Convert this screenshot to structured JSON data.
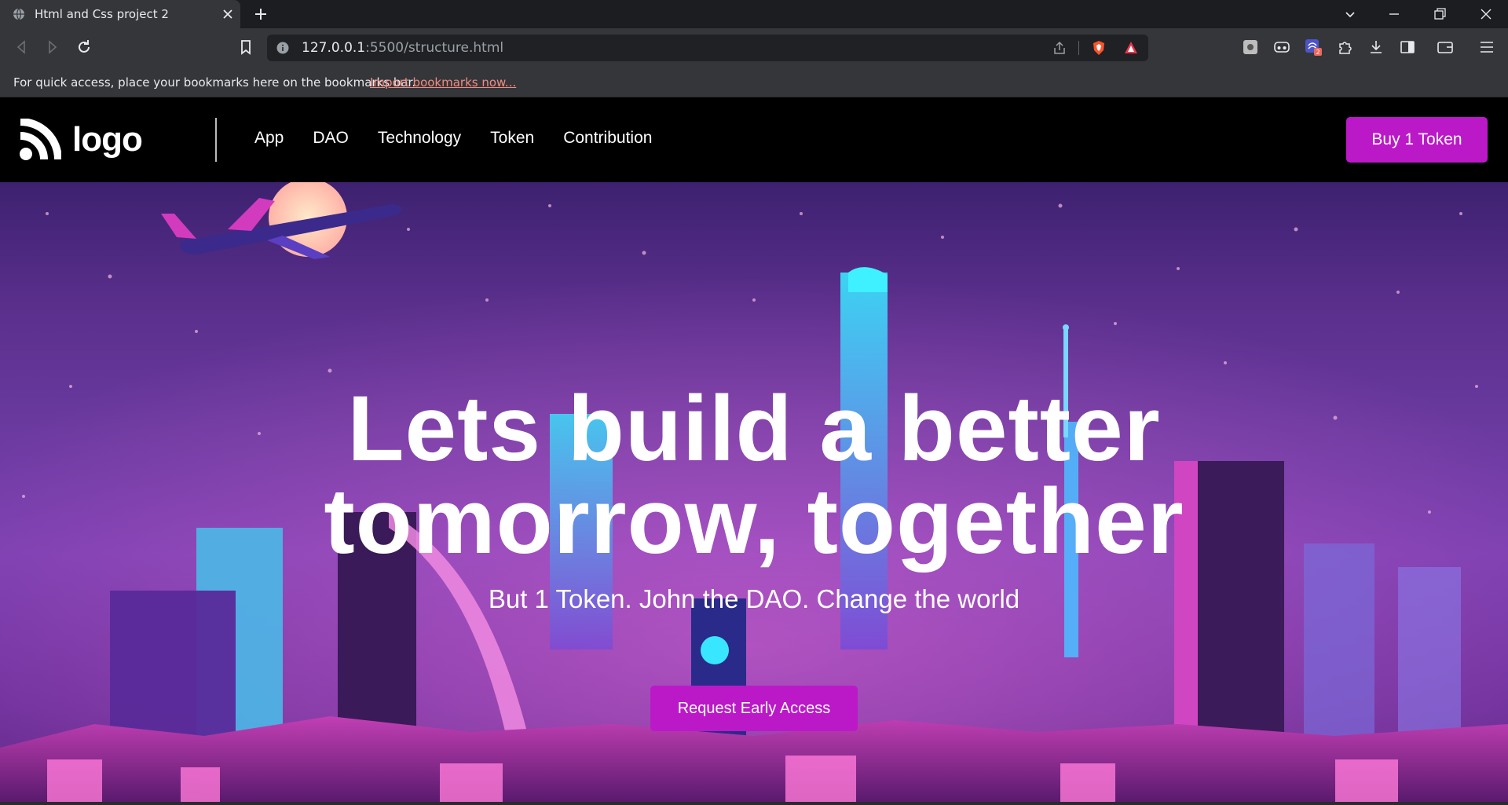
{
  "browser": {
    "tab_title": "Html and Css project 2",
    "url_host": "127.0.0.1",
    "url_path": ":5500/structure.html",
    "bookmarks_prompt": "For quick access, place your bookmarks here on the bookmarks bar.",
    "bookmarks_link": "Import bookmarks now...",
    "extension_badge": "2"
  },
  "nav": {
    "logo_text": "logo",
    "links": [
      "App",
      "DAO",
      "Technology",
      "Token",
      "Contribution"
    ],
    "buy_button": "Buy 1 Token"
  },
  "hero": {
    "title_line1": "Lets build a better",
    "title_line2": "tomorrow, together",
    "subtitle": "But 1 Token. John the DAO. Change the world",
    "cta": "Request Early Access"
  },
  "colors": {
    "accent": "#bb19c8",
    "nav_bg": "#000000",
    "link_red": "#f28b82"
  }
}
